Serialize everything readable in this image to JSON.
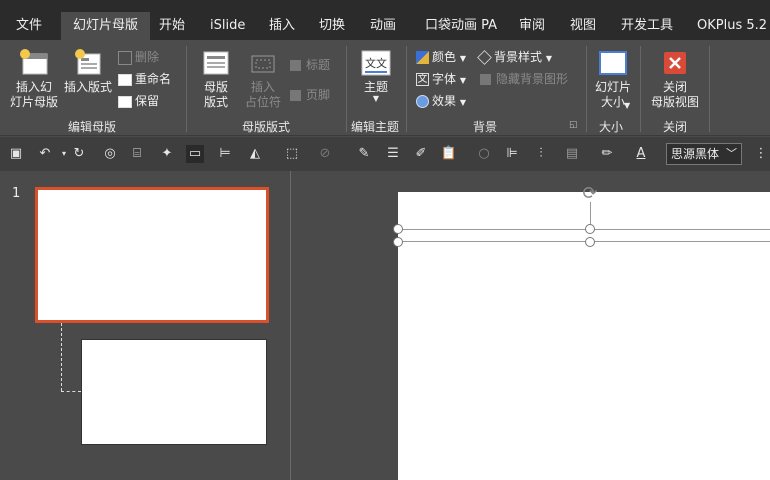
{
  "tabs": [
    {
      "label": "文件"
    },
    {
      "label": "幻灯片母版",
      "active": true
    },
    {
      "label": "开始"
    },
    {
      "label": "iSlide"
    },
    {
      "label": "插入"
    },
    {
      "label": "切换"
    },
    {
      "label": "动画"
    },
    {
      "label": "口袋动画 PA"
    },
    {
      "label": "审阅"
    },
    {
      "label": "视图"
    },
    {
      "label": "开发工具"
    },
    {
      "label": "OKPlus 5.2"
    }
  ],
  "ribbon": {
    "edit_master": {
      "label": "编辑母版",
      "insert_master": "插入幻\n灯片母版",
      "insert_layout": "插入版式",
      "delete": "删除",
      "rename": "重命名",
      "preserve": "保留"
    },
    "master_layout": {
      "label": "母版版式",
      "master_layout_btn": "母版\n版式",
      "insert_placeholder": "插入\n占位符",
      "title_chk": "标题",
      "footer_chk": "页脚"
    },
    "edit_theme": {
      "label": "编辑主题",
      "theme_btn": "主题"
    },
    "background": {
      "label": "背景",
      "colors": "颜色",
      "fonts": "字体",
      "effects": "效果",
      "bg_styles": "背景样式",
      "hide_bg": "隐藏背景图形"
    },
    "size": {
      "label": "大小",
      "slide_size": "幻灯片\n大小"
    },
    "close": {
      "label": "关闭",
      "close_master": "关闭\n母版视图",
      "accent": "#d94a38"
    }
  },
  "qat": {
    "font_name": "思源黑体"
  },
  "thumbnails": {
    "slide_number": "1",
    "accent": "#d9502a"
  }
}
